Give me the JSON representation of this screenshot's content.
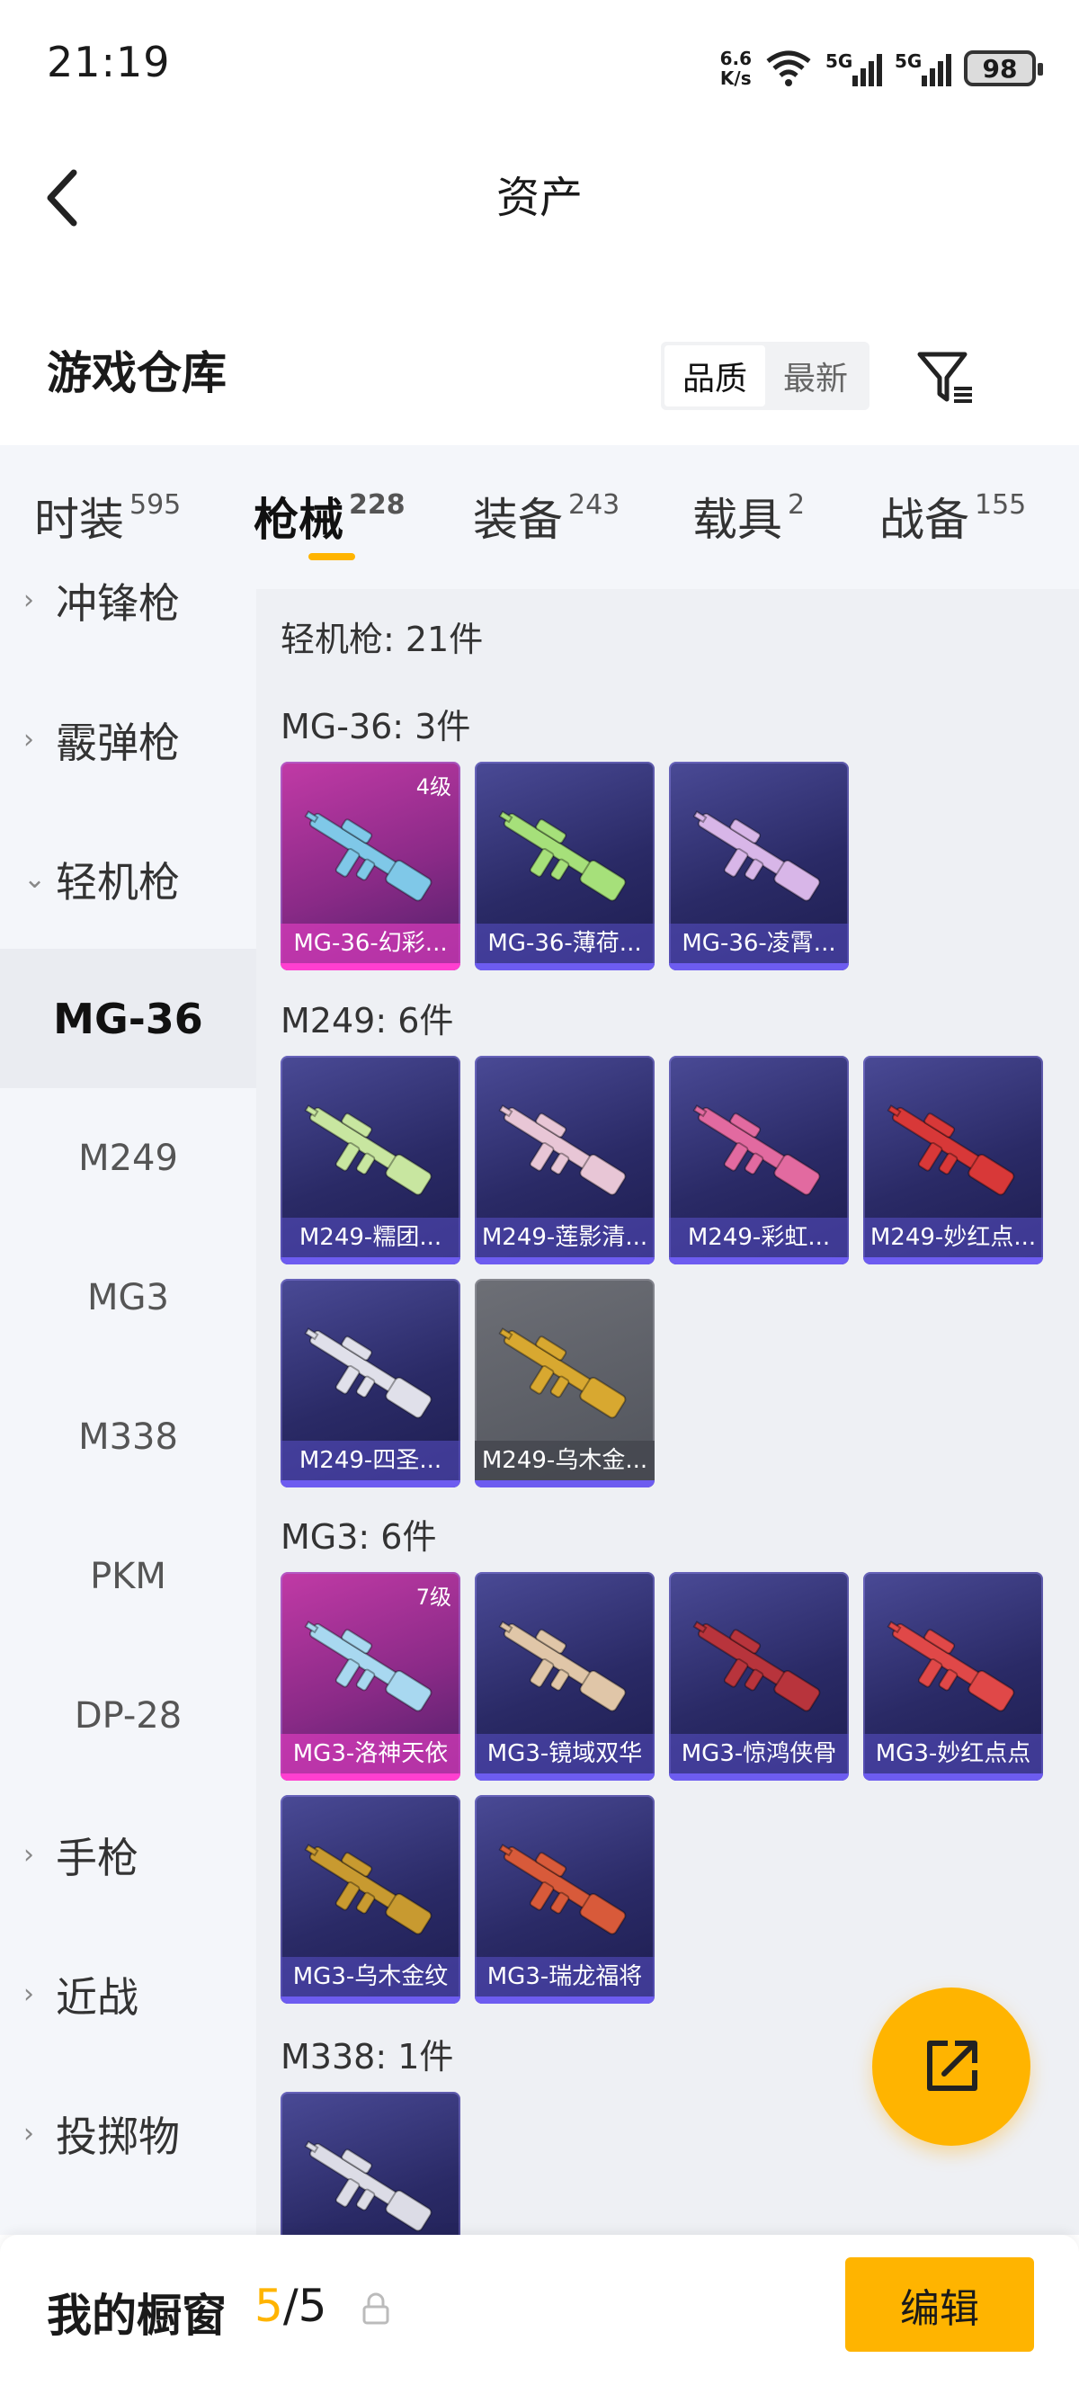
{
  "status": {
    "time": "21:19",
    "net_speed_value": "6.6",
    "net_speed_unit": "K/s",
    "sim1": "5G",
    "sim2": "5G",
    "battery": "98"
  },
  "nav": {
    "title": "资产"
  },
  "warehouse": {
    "title": "游戏仓库",
    "sort_options": [
      "品质",
      "最新"
    ],
    "active_sort": "品质"
  },
  "tabs": [
    {
      "label": "时装",
      "count": "595"
    },
    {
      "label": "枪械",
      "count": "228",
      "active": true
    },
    {
      "label": "装备",
      "count": "243"
    },
    {
      "label": "载具",
      "count": "2"
    },
    {
      "label": "战备",
      "count": "155"
    }
  ],
  "sidebar": {
    "categories": [
      "冲锋枪",
      "霰弹枪",
      "轻机枪",
      "手枪",
      "近战",
      "投掷物"
    ],
    "sub_items": [
      "MG-36",
      "M249",
      "MG3",
      "M338",
      "PKM",
      "DP-28"
    ],
    "active_sub": "MG-36"
  },
  "content": {
    "category_title": "轻机枪: 21件",
    "groups": [
      {
        "title": "MG-36: 3件",
        "items": [
          {
            "name": "MG-36-幻彩...",
            "level": "4级",
            "rarity": "pink",
            "color": "#7fc8e8"
          },
          {
            "name": "MG-36-薄荷...",
            "rarity": "purple",
            "color": "#a6e07a"
          },
          {
            "name": "MG-36-凌霄...",
            "rarity": "purple",
            "color": "#d8b6e8"
          }
        ]
      },
      {
        "title": "M249: 6件",
        "items": [
          {
            "name": "M249-糯团...",
            "rarity": "purple",
            "color": "#c8e6a0"
          },
          {
            "name": "M249-莲影清...",
            "rarity": "purple",
            "color": "#e8c6d6"
          },
          {
            "name": "M249-彩虹...",
            "rarity": "purple",
            "color": "#e26aa0"
          },
          {
            "name": "M249-妙红点...",
            "rarity": "purple",
            "color": "#d83838"
          },
          {
            "name": "M249-四圣...",
            "rarity": "purple",
            "color": "#e0e0ea"
          },
          {
            "name": "M249-乌木金...",
            "rarity": "gray",
            "color": "#d8a830"
          }
        ]
      },
      {
        "title": "MG3: 6件",
        "items": [
          {
            "name": "MG3-洛神天依",
            "level": "7级",
            "rarity": "pink",
            "color": "#a8d8f0"
          },
          {
            "name": "MG3-镜域双华",
            "rarity": "purple",
            "color": "#e0c6a8"
          },
          {
            "name": "MG3-惊鸿侠骨",
            "rarity": "purple",
            "color": "#b8343c"
          },
          {
            "name": "MG3-妙红点点",
            "rarity": "purple",
            "color": "#e04848"
          },
          {
            "name": "MG3-乌木金纹",
            "rarity": "purple",
            "color": "#c89a30"
          },
          {
            "name": "MG3-瑞龙福将",
            "rarity": "purple",
            "color": "#d85a3a"
          }
        ]
      },
      {
        "title": "M338: 1件",
        "items": [
          {
            "name": "",
            "rarity": "purple",
            "color": "#dcdce6"
          }
        ]
      }
    ]
  },
  "showcase": {
    "label": "我的橱窗",
    "used": "5",
    "separator": "/",
    "total": "5",
    "edit_label": "编辑"
  },
  "colors": {
    "accent": "#ffb400",
    "pink_rarity": "#ff3fd0",
    "purple_rarity": "#6d5cf0"
  },
  "icons": {
    "back": "back-arrow-icon",
    "filter": "filter-icon",
    "share": "share-out-icon",
    "lock": "lock-icon",
    "wifi": "wifi-icon"
  }
}
